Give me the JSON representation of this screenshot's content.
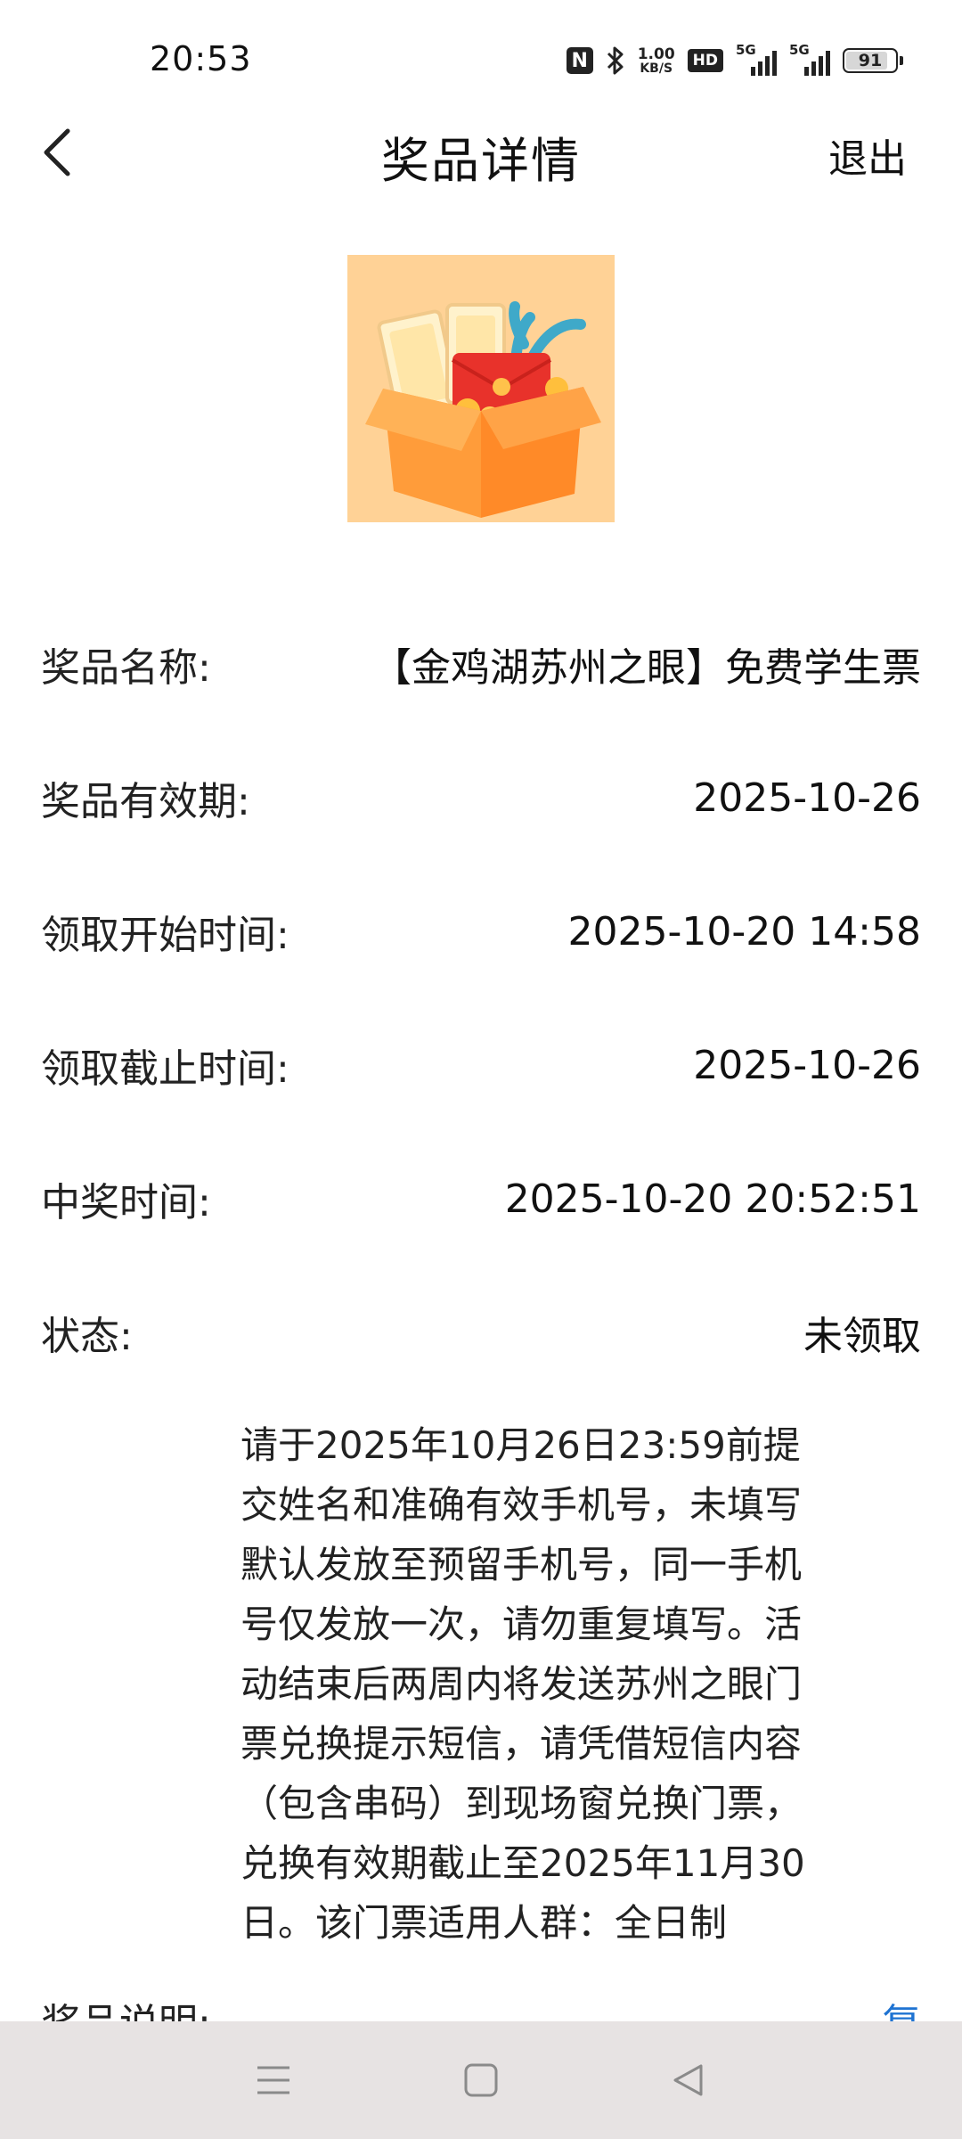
{
  "status_bar": {
    "time": "20:53",
    "net_speed_value": "1.00",
    "net_speed_unit": "KB/S",
    "hd_label": "HD",
    "signal1_label": "5G",
    "signal2_label": "5G",
    "battery_level": "91"
  },
  "header": {
    "title": "奖品详情",
    "exit_label": "退出"
  },
  "prize": {
    "rows": [
      {
        "label": "奖品名称:",
        "value": "【金鸡湖苏州之眼】免费学生票"
      },
      {
        "label": "奖品有效期:",
        "value": "2025-10-26"
      },
      {
        "label": "领取开始时间:",
        "value": "2025-10-20 14:58"
      },
      {
        "label": "领取截止时间:",
        "value": "2025-10-26"
      },
      {
        "label": "中奖时间:",
        "value": "2025-10-20 20:52:51"
      },
      {
        "label": "状态:",
        "value": "未领取"
      }
    ],
    "description_label": "奖品说明:",
    "description": "请于2025年10月26日23:59前提交姓名和准确有效手机号，未填写默认发放至预留手机号，同一手机号仅发放一次，请勿重复填写。活动结束后两周内将发送苏州之眼门票兑换提示短信，请凭借短信内容（包含串码）到现场窗兑换门票，兑换有效期截止至2025年11月30日。该门票适用人群：全日制",
    "expand_label": "复"
  },
  "icons": {
    "back": "chevron-left-icon",
    "nfc": "nfc-icon",
    "bluetooth": "bluetooth-icon",
    "menu": "menu-icon",
    "home": "home-icon",
    "nav_back": "triangle-back-icon"
  },
  "colors": {
    "link": "#1e73d2",
    "nav_bg": "#e7e3e3",
    "image_bg": "#ffd296"
  }
}
